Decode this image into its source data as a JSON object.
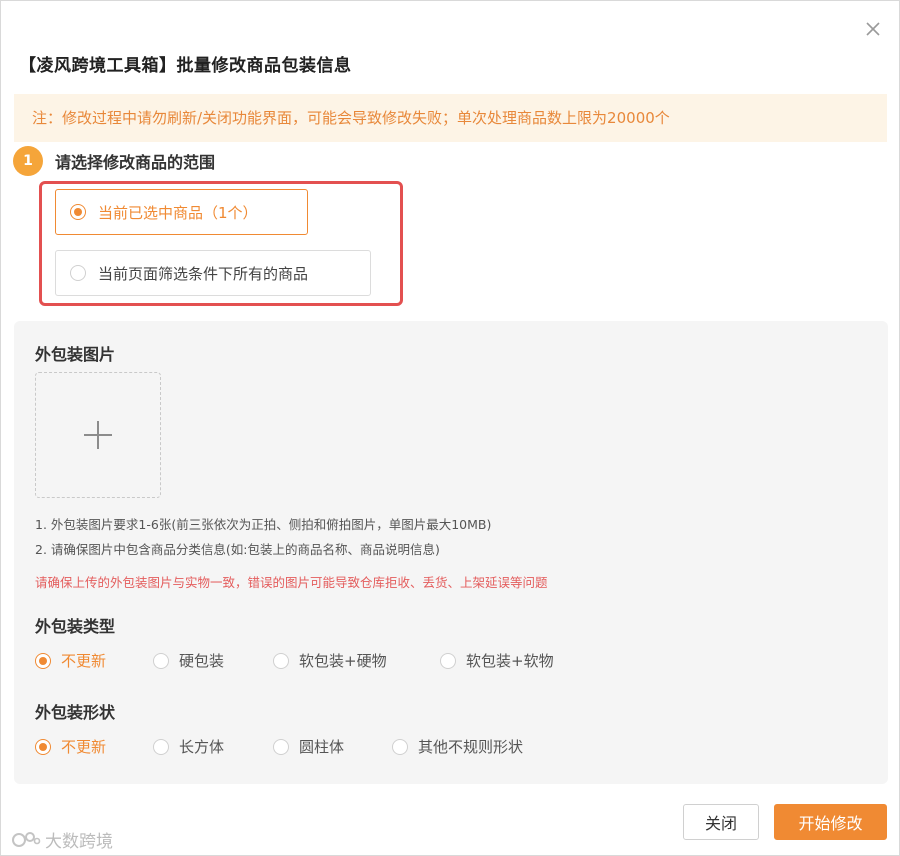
{
  "dialog": {
    "title": "【凌风跨境工具箱】批量修改商品包装信息",
    "notice": "注：修改过程中请勿刷新/关闭功能界面，可能会导致修改失败；单次处理商品数上限为20000个"
  },
  "step": {
    "number": "1",
    "label": "请选择修改商品的范围"
  },
  "scope_options": [
    {
      "label": "当前已选中商品（1个）",
      "selected": true
    },
    {
      "label": "当前页面筛选条件下所有的商品",
      "selected": false
    }
  ],
  "image_section": {
    "title": "外包装图片",
    "hint1": "1. 外包装图片要求1-6张(前三张依次为正拍、侧拍和俯拍图片，单图片最大10MB)",
    "hint2": "2. 请确保图片中包含商品分类信息(如:包装上的商品名称、商品说明信息)",
    "warning": "请确保上传的外包装图片与实物一致，错误的图片可能导致仓库拒收、丢货、上架延误等问题"
  },
  "package_type": {
    "title": "外包装类型",
    "options": [
      "不更新",
      "硬包装",
      "软包装+硬物",
      "软包装+软物"
    ],
    "selected_index": 0
  },
  "package_shape": {
    "title": "外包装形状",
    "options": [
      "不更新",
      "长方体",
      "圆柱体",
      "其他不规则形状"
    ],
    "selected_index": 0
  },
  "buttons": {
    "close": "关闭",
    "start": "开始修改"
  },
  "watermark": "大数跨境",
  "colors": {
    "accent": "#f08a33",
    "notice_bg": "#fdf4e6",
    "warning": "#e45d5d",
    "highlight_border": "#e35050"
  }
}
